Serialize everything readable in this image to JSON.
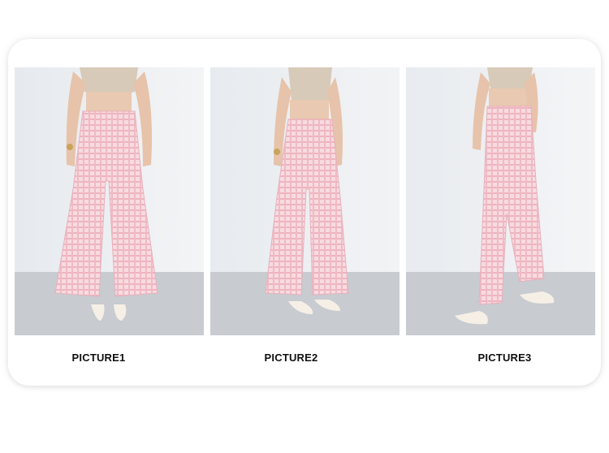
{
  "captions": [
    "PICTURE1",
    "PICTURE2",
    "PICTURE3"
  ],
  "colors": {
    "wall": "#eef0f3",
    "floor": "#c7cacf",
    "pants_pink": "#f3c8cf",
    "top_beige": "#d9ccbc",
    "skin": "#e8c6ae"
  }
}
